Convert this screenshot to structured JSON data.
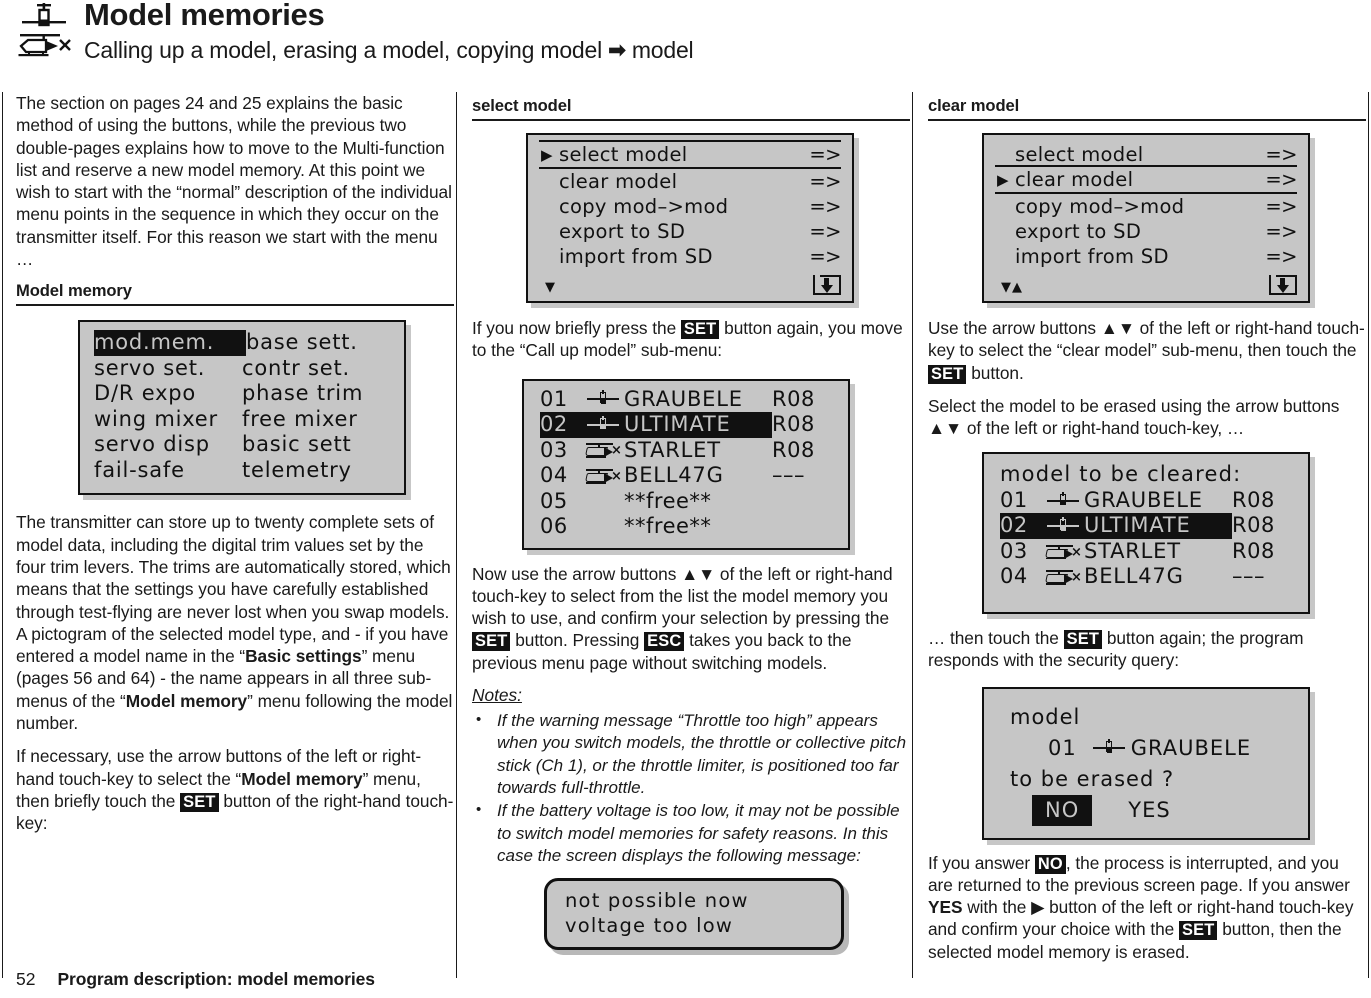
{
  "header": {
    "title": "Model memories",
    "subtitle_before": "Calling up a model, erasing a model, copying model ",
    "subtitle_arrow": "➡",
    "subtitle_after": " model",
    "icon_plane": "airplane-pictogram",
    "icon_heli": "helicopter-pictogram"
  },
  "col1": {
    "intro": "The section on pages 24 and 25 explains the basic method of using the buttons, while the previous two double-pages explains how to move to the Multi-function list and reserve a new model memory. At this point we wish to start with the “normal” description of the individual menu points in the sequence in which they occur on the transmitter itself. For this reason we start with the menu …",
    "heading": "Model memory",
    "menu_screen": {
      "rows": [
        {
          "left": "mod.mem.",
          "left_highlighted": true,
          "right": "base  sett."
        },
        {
          "left": "servo  set.",
          "left_highlighted": false,
          "right": "contr  set."
        },
        {
          "left": "D/R  expo",
          "left_highlighted": false,
          "right": "phase  trim"
        },
        {
          "left": "wing  mixer",
          "left_highlighted": false,
          "right": "free  mixer"
        },
        {
          "left": "servo  disp",
          "left_highlighted": false,
          "right": "basic  sett"
        },
        {
          "left": "fail-safe",
          "left_highlighted": false,
          "right": "telemetry"
        }
      ]
    },
    "para2_a": "The transmitter can store up to twenty complete sets of model data, including the digital trim values set by the four trim levers. The trims are automatically stored, which means that the settings you have carefully established through test-flying are never lost when you swap models. A pictogram of the selected model type, and - if you have entered a model name in the “",
    "para2_b": "Basic settings",
    "para2_c": "” menu (pages 56 and 64) - the name appears in all three sub-menus of the “",
    "para2_d": "Model memory",
    "para2_e": "” menu following the model number.",
    "para3_a": "If necessary, use the arrow buttons of the left or right-hand touch-key to select the “",
    "para3_b": "Model memory",
    "para3_c": "” menu, then briefly touch the ",
    "para3_key": "SET",
    "para3_d": " button of the right-hand touch-key:"
  },
  "col2": {
    "heading": "select model",
    "menu_screen": {
      "rows": [
        {
          "label": "select  model",
          "value": "=>",
          "cursor": true,
          "selected": true
        },
        {
          "label": "clear  model",
          "value": "=>",
          "cursor": false,
          "selected": false
        },
        {
          "label": "copy  mod–>mod",
          "value": "=>",
          "cursor": false,
          "selected": false
        },
        {
          "label": "export  to  SD",
          "value": "=>",
          "cursor": false,
          "selected": false
        },
        {
          "label": "import  from  SD",
          "value": "=>",
          "cursor": false,
          "selected": false
        }
      ],
      "scroll_arrows": "▼",
      "sd_icon": "sd-card-download-icon"
    },
    "para1_a": "If you now briefly press the ",
    "para1_key": "SET",
    "para1_b": " button again, you move to the “Call up model” sub-menu:",
    "model_list": {
      "rows": [
        {
          "num": "01",
          "pic": "plane",
          "name": "GRAUBELE",
          "rx": "R08",
          "selected": false
        },
        {
          "num": "02",
          "pic": "plane",
          "name": "ULTIMATE",
          "rx": "R08",
          "selected": true
        },
        {
          "num": "03",
          "pic": "heli",
          "name": "STARLET",
          "rx": "R08",
          "selected": false
        },
        {
          "num": "04",
          "pic": "heli",
          "name": "BELL47G",
          "rx": "–––",
          "selected": false
        },
        {
          "num": "05",
          "pic": "none",
          "name": "**free**",
          "rx": "",
          "selected": false
        },
        {
          "num": "06",
          "pic": "none",
          "name": "**free**",
          "rx": "",
          "selected": false
        }
      ]
    },
    "para2_a": "Now use the arrow buttons ",
    "para2_arrows": "▲▼",
    "para2_b": " of the left or right-hand touch-key to select from the list the model memory you wish to use, and confirm your selection by pressing the ",
    "para2_key1": "SET",
    "para2_c": " button. Pressing ",
    "para2_key2": "ESC",
    "para2_d": " takes you back to the previous menu page without switching models.",
    "notes_label": "Notes:",
    "notes": [
      "If the warning message “Throttle too high” appears when you switch models, the throttle or collective pitch stick (Ch 1), or the throttle limiter, is positioned too far towards full-throttle.",
      "If the battery voltage is too low, it may not be possible to switch model memories for safety reasons. In this case the screen displays the following message:"
    ],
    "alert": {
      "line1": "not  possible  now",
      "line2": "voltage  too  low"
    }
  },
  "col3": {
    "heading": "clear model",
    "menu_screen": {
      "rows": [
        {
          "label": "select  model",
          "value": "=>",
          "cursor": false,
          "selected": false
        },
        {
          "label": "clear  model",
          "value": "=>",
          "cursor": true,
          "selected": true
        },
        {
          "label": "copy  mod–>mod",
          "value": "=>",
          "cursor": false,
          "selected": false
        },
        {
          "label": "export  to  SD",
          "value": "=>",
          "cursor": false,
          "selected": false
        },
        {
          "label": "import  from  SD",
          "value": "=>",
          "cursor": false,
          "selected": false
        }
      ],
      "scroll_arrows": "▼▲",
      "sd_icon": "sd-card-download-icon"
    },
    "para1_a": "Use the arrow buttons ",
    "para1_arrows": "▲▼",
    "para1_b": " of the left or right-hand touch-key to select the “clear model” sub-menu, then touch the ",
    "para1_key": "SET",
    "para1_c": " button.",
    "para2_a": "Select the model to be erased using the arrow buttons ",
    "para2_arrows": "▲▼",
    "para2_b": " of the left or right-hand touch-key, …",
    "clear_list": {
      "title": "model  to  be  cleared:",
      "rows": [
        {
          "num": "01",
          "pic": "plane",
          "name": "GRAUBELE",
          "rx": "R08",
          "selected": false
        },
        {
          "num": "02",
          "pic": "plane",
          "name": "ULTIMATE",
          "rx": "R08",
          "selected": true
        },
        {
          "num": "03",
          "pic": "heli",
          "name": "STARLET",
          "rx": "R08",
          "selected": false
        },
        {
          "num": "04",
          "pic": "heli",
          "name": "BELL47G",
          "rx": "–––",
          "selected": false
        }
      ]
    },
    "para3_a": "… then touch the ",
    "para3_key": "SET",
    "para3_b": " button again; the program responds with the security query:",
    "confirm": {
      "line_model": "model",
      "num": "01",
      "pic": "plane",
      "name": "GRAUBELE",
      "line_question": "to  be  erased   ?",
      "no": "NO",
      "yes": "YES"
    },
    "para4_a": "If you answer ",
    "para4_key_no": "NO",
    "para4_b": ", the process is interrupted, and you are returned to the previous screen page. If you answer ",
    "para4_yes": "YES",
    "para4_c": " with the ",
    "para4_rightarrow": "▶",
    "para4_d": " button of the left or right-hand touch-key and confirm your choice with the ",
    "para4_key_set": "SET",
    "para4_e": " button, then the selected model memory is erased."
  },
  "footer": {
    "page_number": "52",
    "page_title": "Program description: model memories"
  }
}
